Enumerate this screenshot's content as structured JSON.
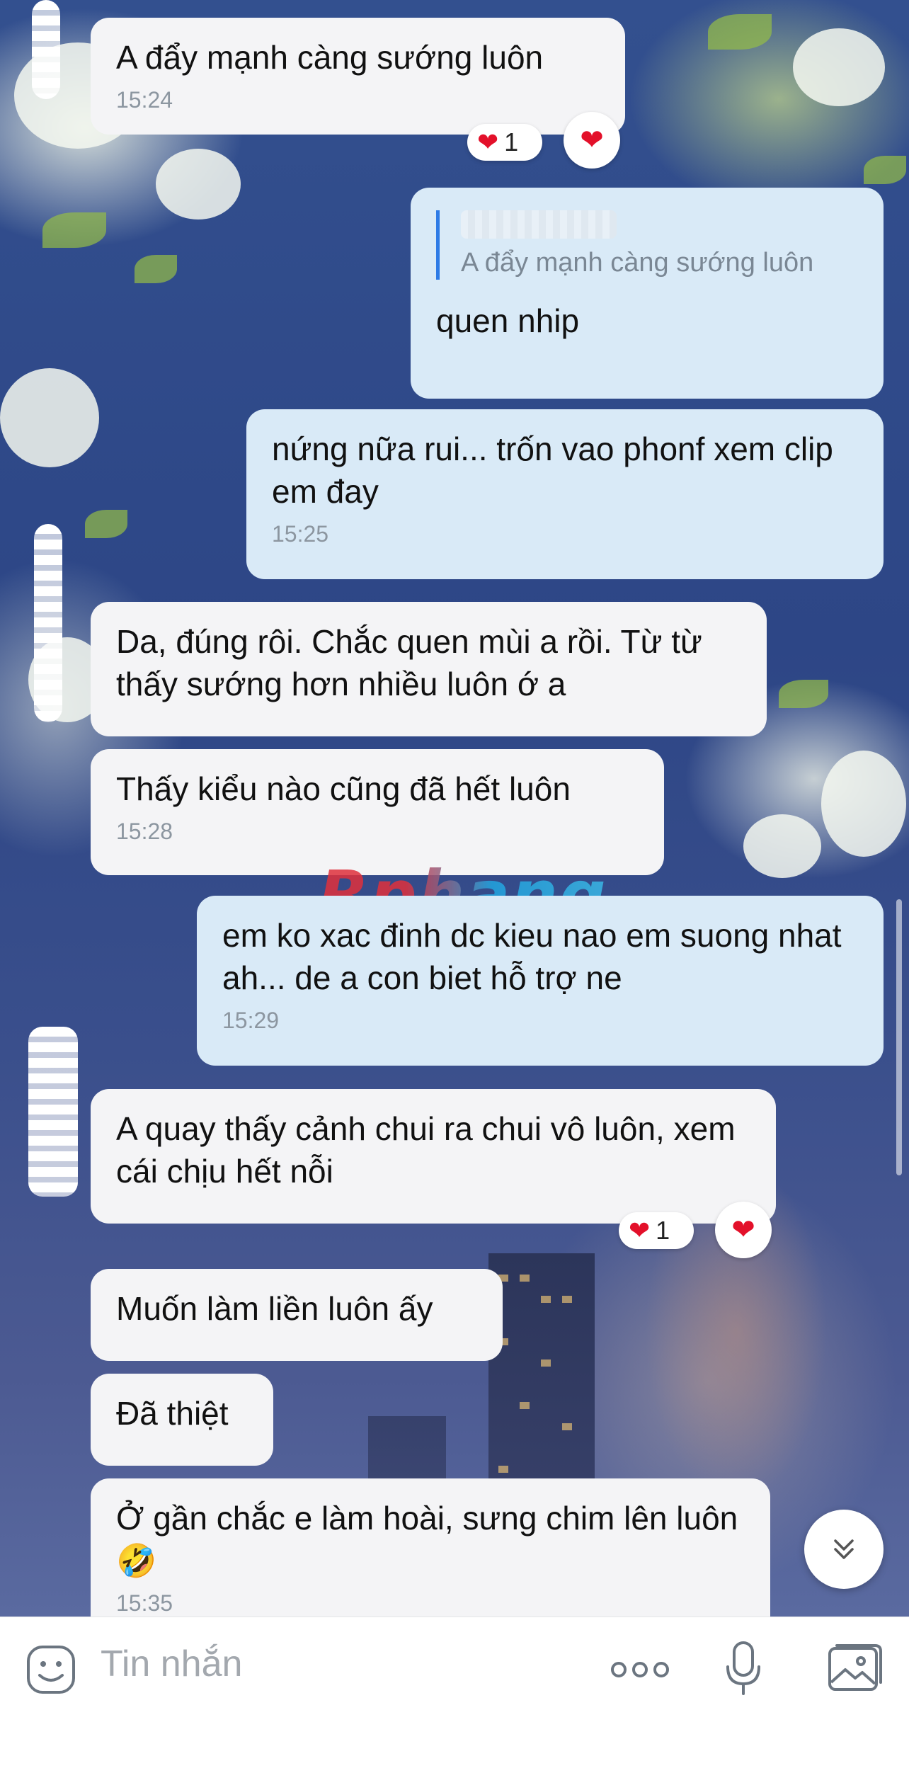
{
  "messages": [
    {
      "side": "in",
      "text": "A đẩy mạnh càng sướng luôn",
      "time": "15:24",
      "reaction_count": "1"
    },
    {
      "side": "out",
      "quote": "A đẩy mạnh càng sướng luôn",
      "text": "quen nhip"
    },
    {
      "side": "out",
      "text": "nứng nữa rui... trốn vao phonf xem clip em đay",
      "time": "15:25"
    },
    {
      "side": "in",
      "text": "Da, đúng rôi. Chắc quen mùi a rồi. Từ từ thấy sướng hơn nhiều luôn ớ a"
    },
    {
      "side": "in",
      "text": "Thấy kiểu nào cũng đã hết luôn",
      "time": "15:28"
    },
    {
      "side": "out",
      "text": "em ko xac đinh dc kieu nao em suong nhat ah... de a con biet hỗ trợ ne",
      "time": "15:29"
    },
    {
      "side": "in",
      "text": "A quay thấy cảnh chui ra chui vô luôn, xem cái chịu hết nỗi",
      "reaction_count": "1"
    },
    {
      "side": "in",
      "text": "Muốn làm liền luôn ấy"
    },
    {
      "side": "in",
      "text": "Đã thiệt"
    },
    {
      "side": "in",
      "text": "Ở gần chắc e làm hoài, sưng chim lên luôn 🤣",
      "time": "15:35"
    }
  ],
  "watermark": "Rphang",
  "composer": {
    "placeholder": "Tin nhắn",
    "icons": [
      "sticker-icon",
      "more-icon",
      "microphone-icon",
      "image-icon"
    ]
  },
  "colors": {
    "incoming_bubble": "#f4f4f6",
    "outgoing_bubble": "#d9eaf7",
    "heart": "#e3102a",
    "quote_bar": "#2e7be6"
  }
}
